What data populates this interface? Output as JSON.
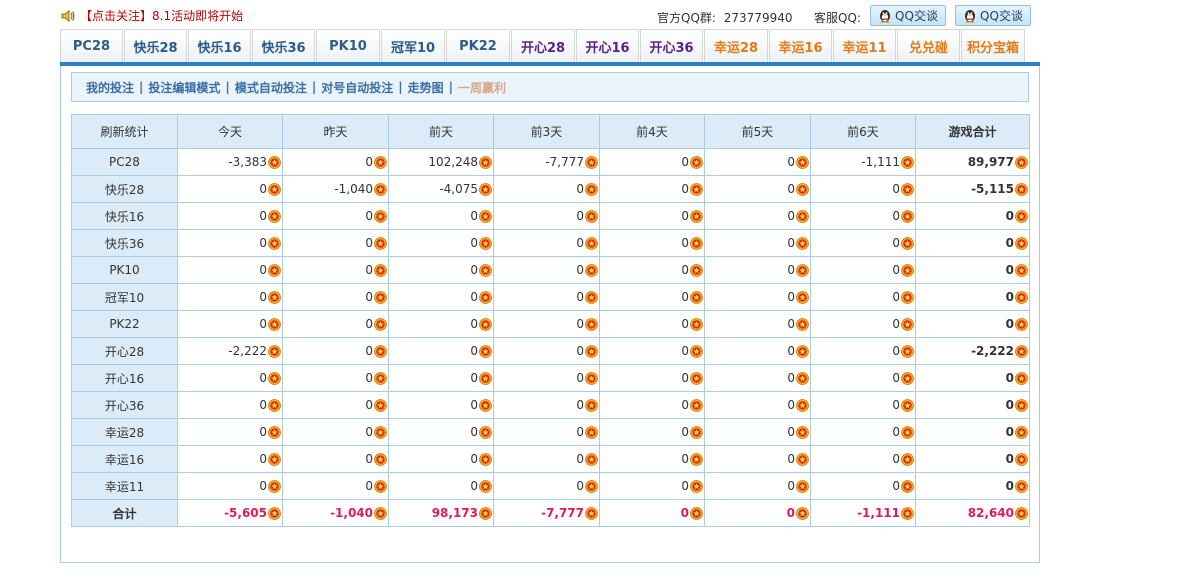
{
  "notice": {
    "bracket_text": "【点击关注】",
    "text": "8.1活动即将开始"
  },
  "contact": {
    "qq_group_label": "官方QQ群:",
    "qq_group_number": "273779940",
    "kefu_label": "客服QQ:",
    "qq_buttons": [
      "QQ交谈",
      "QQ交谈"
    ]
  },
  "tabs": [
    {
      "label": "PC28",
      "color": "blue"
    },
    {
      "label": "快乐28",
      "color": "blue"
    },
    {
      "label": "快乐16",
      "color": "blue"
    },
    {
      "label": "快乐36",
      "color": "blue"
    },
    {
      "label": "PK10",
      "color": "blue"
    },
    {
      "label": "冠军10",
      "color": "blue"
    },
    {
      "label": "PK22",
      "color": "blue"
    },
    {
      "label": "开心28",
      "color": "purple"
    },
    {
      "label": "开心16",
      "color": "purple"
    },
    {
      "label": "开心36",
      "color": "purple"
    },
    {
      "label": "幸运28",
      "color": "orange"
    },
    {
      "label": "幸运16",
      "color": "orange"
    },
    {
      "label": "幸运11",
      "color": "orange"
    },
    {
      "label": "兑兑碰",
      "color": "orange"
    },
    {
      "label": "积分宝箱",
      "color": "orange"
    }
  ],
  "subnav": [
    {
      "label": "我的投注",
      "active": false
    },
    {
      "label": "投注编辑模式",
      "active": false
    },
    {
      "label": "模式自动投注",
      "active": false
    },
    {
      "label": "对号自动投注",
      "active": false
    },
    {
      "label": "走势图",
      "active": false
    },
    {
      "label": "一周赢利",
      "active": true
    }
  ],
  "table": {
    "headers": [
      "刷新统计",
      "今天",
      "昨天",
      "前天",
      "前3天",
      "前4天",
      "前5天",
      "前6天",
      "游戏合计"
    ],
    "rows": [
      {
        "name": "PC28",
        "values": [
          "-3,383",
          "0",
          "102,248",
          "-7,777",
          "0",
          "0",
          "-1,111",
          "89,977"
        ]
      },
      {
        "name": "快乐28",
        "values": [
          "0",
          "-1,040",
          "-4,075",
          "0",
          "0",
          "0",
          "0",
          "-5,115"
        ]
      },
      {
        "name": "快乐16",
        "values": [
          "0",
          "0",
          "0",
          "0",
          "0",
          "0",
          "0",
          "0"
        ]
      },
      {
        "name": "快乐36",
        "values": [
          "0",
          "0",
          "0",
          "0",
          "0",
          "0",
          "0",
          "0"
        ]
      },
      {
        "name": "PK10",
        "values": [
          "0",
          "0",
          "0",
          "0",
          "0",
          "0",
          "0",
          "0"
        ]
      },
      {
        "name": "冠军10",
        "values": [
          "0",
          "0",
          "0",
          "0",
          "0",
          "0",
          "0",
          "0"
        ]
      },
      {
        "name": "PK22",
        "values": [
          "0",
          "0",
          "0",
          "0",
          "0",
          "0",
          "0",
          "0"
        ]
      },
      {
        "name": "开心28",
        "values": [
          "-2,222",
          "0",
          "0",
          "0",
          "0",
          "0",
          "0",
          "-2,222"
        ]
      },
      {
        "name": "开心16",
        "values": [
          "0",
          "0",
          "0",
          "0",
          "0",
          "0",
          "0",
          "0"
        ]
      },
      {
        "name": "开心36",
        "values": [
          "0",
          "0",
          "0",
          "0",
          "0",
          "0",
          "0",
          "0"
        ]
      },
      {
        "name": "幸运28",
        "values": [
          "0",
          "0",
          "0",
          "0",
          "0",
          "0",
          "0",
          "0"
        ]
      },
      {
        "name": "幸运16",
        "values": [
          "0",
          "0",
          "0",
          "0",
          "0",
          "0",
          "0",
          "0"
        ]
      },
      {
        "name": "幸运11",
        "values": [
          "0",
          "0",
          "0",
          "0",
          "0",
          "0",
          "0",
          "0"
        ]
      }
    ],
    "sum_row": {
      "name": "合计",
      "values": [
        "-5,605",
        "-1,040",
        "98,173",
        "-7,777",
        "0",
        "0",
        "-1,111",
        "82,640"
      ]
    }
  },
  "colors": {
    "accent_blue": "#2f7fc2",
    "sum_red": "#e0195e",
    "notice_red": "#c00000",
    "header_bg": "#dbecf8"
  }
}
